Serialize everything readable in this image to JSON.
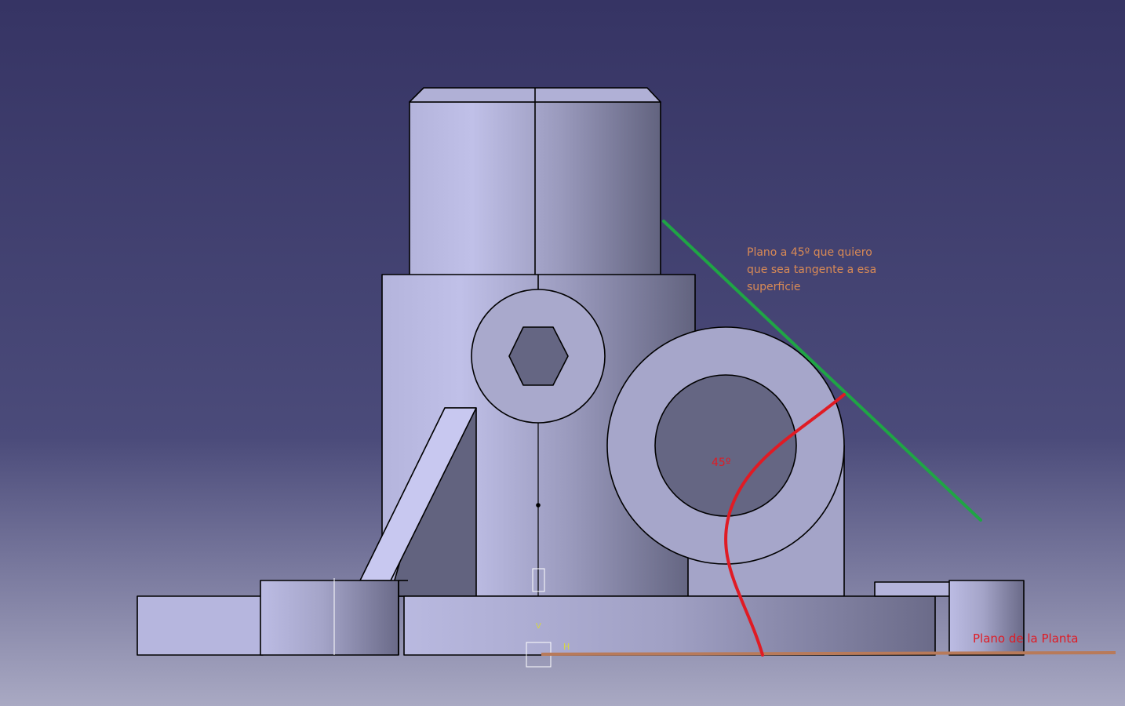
{
  "colors": {
    "background_top": "#363464",
    "background_bottom": "#a9a9c3",
    "part_light": "#c0c0e8",
    "part_mid": "#a6a6cc",
    "part_dark": "#656683",
    "tangent_plane": "#1fa545",
    "angle_curve": "#e01b24",
    "floor_plane": "#b87a5a",
    "note_plane_text": "#d98a55",
    "note_angle_text": "#e01b24",
    "note_floor_text": "#e01b24",
    "axis_marker": "#d8d840"
  },
  "annotations": {
    "plane_note_lines": [
      "Plano a 45º que quiero",
      "que sea tangente a esa",
      "superficie"
    ],
    "angle_label": "45º",
    "floor_label": "Plano de la Planta"
  },
  "axes": {
    "h_label": "H",
    "v_label": "V"
  }
}
